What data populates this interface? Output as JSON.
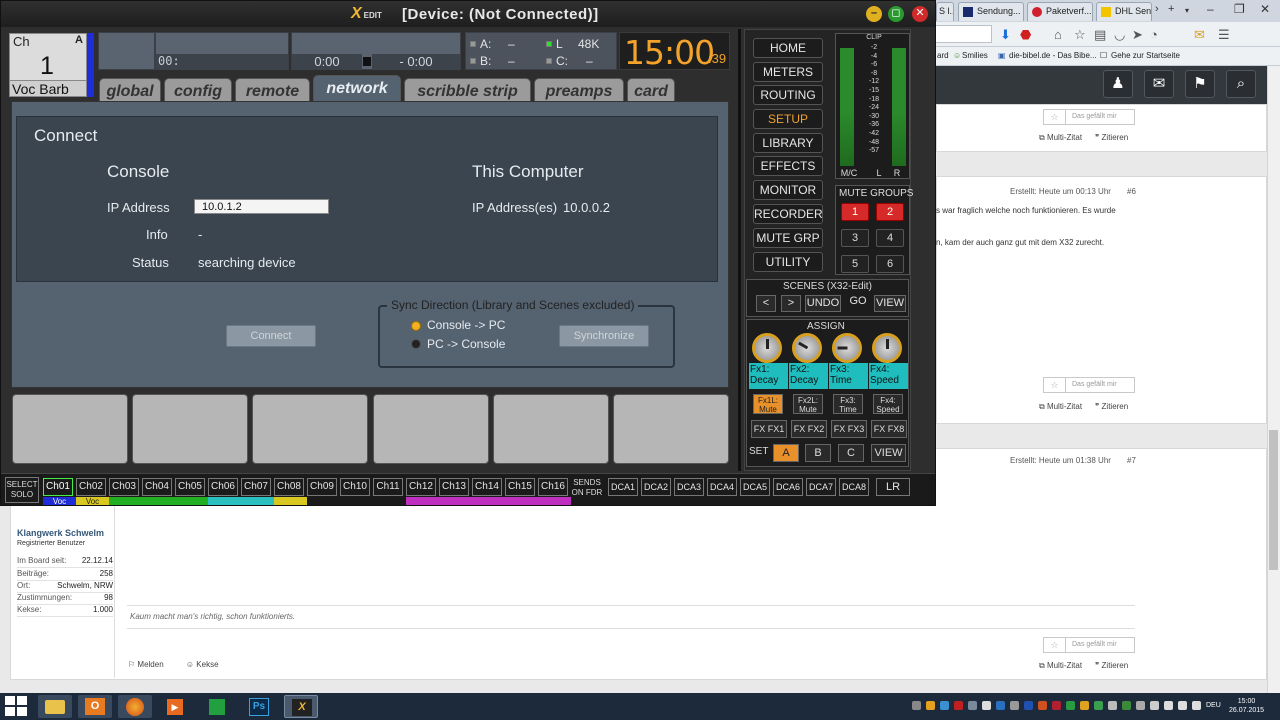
{
  "browser": {
    "tabs": [
      {
        "label": "S l...",
        "icon_color": "#3a62b0"
      },
      {
        "label": "Sendung...",
        "icon_color": "#1a2a6e"
      },
      {
        "label": "Paketverf...",
        "icon_color": "#d0202e"
      },
      {
        "label": "DHL Sen...",
        "icon_color": "#f5c400"
      }
    ],
    "bookmarks": {
      "item1": "ard",
      "item2": "Smilies",
      "item3": "die-bibel.de - Das Bibe...",
      "item4": "Gehe zur Startseite"
    }
  },
  "forum": {
    "like_label": "Das gefällt mir",
    "multi_quote": "Multi-Zitat",
    "quote": "Zitieren",
    "post6": {
      "created": "Erstellt: Heute um 00:13 Uhr",
      "number": "#6",
      "line1": "s war fraglich welche noch funktionieren. Es wurde",
      "line2": "n, kam der auch ganz gut mit dem X32 zurecht."
    },
    "post7": {
      "created": "Erstellt: Heute um 01:38 Uhr",
      "number": "#7"
    },
    "profile": {
      "name": "Klangwerk Schwelm",
      "rank": "Registrierter Benutzer",
      "rows": [
        {
          "k": "Im Board seit:",
          "v": "22.12.14"
        },
        {
          "k": "Beiträge:",
          "v": "258"
        },
        {
          "k": "Ort:",
          "v": "Schwelm, NRW"
        },
        {
          "k": "Zustimmungen:",
          "v": "98"
        },
        {
          "k": "Kekse:",
          "v": "1.000"
        }
      ]
    },
    "signature": "Kaum macht man's richtig, schon funktionierts.",
    "report": "Melden",
    "cookies": "Kekse"
  },
  "taskbar": {
    "lang": "DEU",
    "time": "15:00",
    "date": "26.07.2015"
  },
  "x32": {
    "logo": "X",
    "logo_sub": "EDIT",
    "title": "[Device: (Not Connected)]",
    "channel": {
      "label": "Ch",
      "bank": "A",
      "number": "1",
      "name": "Voc Barb"
    },
    "lcd2_text": "00:",
    "time_left": "0:00",
    "time_right": "- 0:00",
    "status": {
      "a": "A:",
      "a_val": "–",
      "b": "B:",
      "b_val": "–",
      "l": "L",
      "rate": "48K",
      "c": "C:",
      "c_val": "–"
    },
    "clock": {
      "hm": "15:00",
      "sec": ":39"
    },
    "tabs": [
      "global",
      "config",
      "remote",
      "network",
      "scribble strip",
      "preamps",
      "card"
    ],
    "active_tab": "network",
    "connect": {
      "heading": "Connect",
      "console": "Console",
      "this_computer": "This Computer",
      "ip_label": "IP Address",
      "ip_value": "10.0.1.2",
      "info_label": "Info",
      "info_value": "-",
      "status_label": "Status",
      "status_value": "searching device",
      "pc_ip_label": "IP Address(es)",
      "pc_ip_value": "10.0.0.2"
    },
    "sync": {
      "legend": "Sync Direction (Library and Scenes excluded)",
      "opt1": "Console -> PC",
      "opt2": "PC -> Console",
      "connect_btn": "Connect",
      "sync_btn": "Synchronize"
    },
    "nav": [
      "HOME",
      "METERS",
      "ROUTING",
      "SETUP",
      "LIBRARY",
      "EFFECTS",
      "MONITOR",
      "RECORDER",
      "MUTE GRP",
      "UTILITY"
    ],
    "active_nav": "SETUP",
    "meter": {
      "clip": "CLIP",
      "scale": [
        "-2",
        "-4",
        "-6",
        "-8",
        "-12",
        "-15",
        "-18",
        "-24",
        "-30",
        "-36",
        "-42",
        "-48",
        "",
        "-57"
      ],
      "mc": "M/C",
      "l": "L",
      "r": "R"
    },
    "mute_groups": {
      "title": "MUTE GROUPS",
      "buttons": [
        "1",
        "2",
        "3",
        "4",
        "5",
        "6"
      ],
      "active": [
        1,
        2
      ]
    },
    "scenes": {
      "title": "SCENES (X32-Edit)",
      "prev": "<",
      "next": ">",
      "undo": "UNDO",
      "go": "GO",
      "view": "VIEW"
    },
    "assign": {
      "title": "ASSIGN",
      "lcds": [
        [
          "Fx1:",
          "Decay"
        ],
        [
          "Fx2:",
          "Decay"
        ],
        [
          "Fx3:",
          "Time"
        ],
        [
          "Fx4:",
          "Speed"
        ]
      ],
      "fxbtns": [
        [
          "Fx1L:",
          "Mute"
        ],
        [
          "Fx2L:",
          "Mute"
        ],
        [
          "Fx3:",
          "Time"
        ],
        [
          "Fx4:",
          "Speed"
        ]
      ],
      "fxsends": [
        "FX FX1",
        "FX FX2",
        "FX FX3",
        "FX FX8"
      ],
      "set": "SET",
      "sets": [
        "A",
        "B",
        "C"
      ],
      "view": "VIEW"
    },
    "strip": {
      "select": "SELECT",
      "solo": "SOLO",
      "channels": [
        "Ch01",
        "Ch02",
        "Ch03",
        "Ch04",
        "Ch05",
        "Ch06",
        "Ch07",
        "Ch08",
        "Ch09",
        "Ch10",
        "Ch11",
        "Ch12",
        "Ch13",
        "Ch14",
        "Ch15",
        "Ch16"
      ],
      "sends": "SENDS",
      "on_fdr": "ON FDR",
      "dcas": [
        "DCA1",
        "DCA2",
        "DCA3",
        "DCA4",
        "DCA5",
        "DCA6",
        "DCA7",
        "DCA8"
      ],
      "lr": "LR",
      "name1": "Voc",
      "name2": "Voc"
    },
    "colors": {
      "accent": "#f0a030",
      "channel_blue": "#1f2dd8",
      "mute_red": "#d62a2a",
      "fx_cyan": "#1fbdbd"
    }
  }
}
